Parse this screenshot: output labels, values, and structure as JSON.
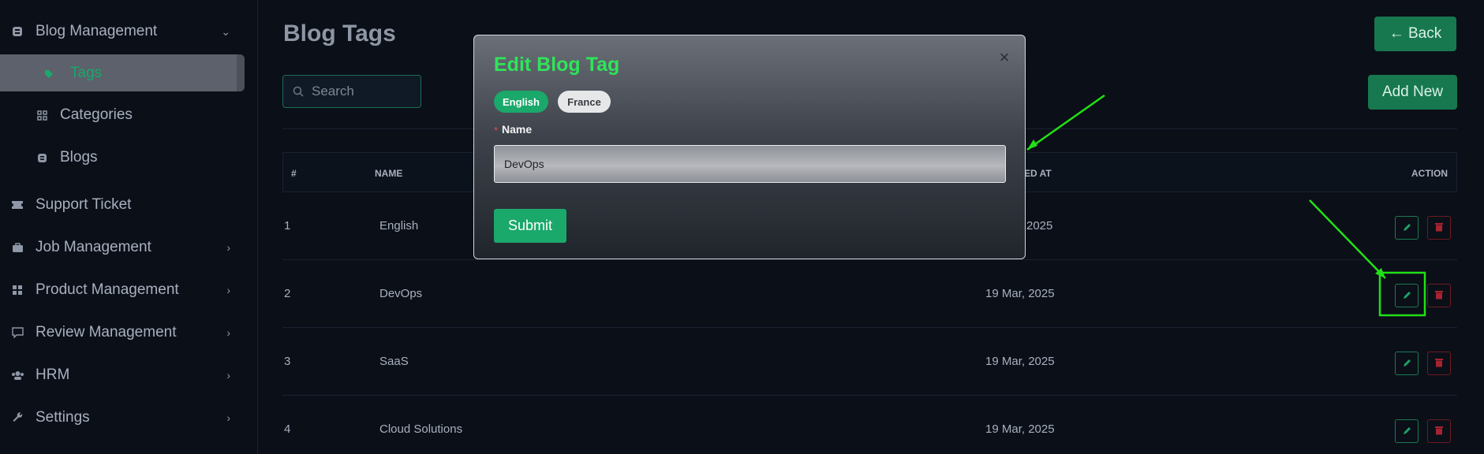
{
  "sidebar": {
    "blog_management": "Blog Management",
    "tags": "Tags",
    "categories": "Categories",
    "blogs": "Blogs",
    "support_ticket": "Support Ticket",
    "job_management": "Job Management",
    "product_management": "Product Management",
    "review_management": "Review Management",
    "hrm": "HRM",
    "settings": "Settings"
  },
  "header": {
    "title": "Blog Tags",
    "back_label": "← Back"
  },
  "toolbar": {
    "search_placeholder": "Search",
    "add_new_label": "Add New"
  },
  "table": {
    "headers": {
      "num": "#",
      "name": "NAME",
      "created_at": "SED AT",
      "action": "ACTION"
    },
    "rows": [
      {
        "num": "1",
        "name": "English",
        "created_at": "2025"
      },
      {
        "num": "2",
        "name": "DevOps",
        "created_at": "19 Mar, 2025"
      },
      {
        "num": "3",
        "name": "SaaS",
        "created_at": "19 Mar, 2025"
      },
      {
        "num": "4",
        "name": "Cloud Solutions",
        "created_at": "19 Mar, 2025"
      }
    ]
  },
  "modal": {
    "title": "Edit Blog Tag",
    "close": "×",
    "lang_english": "English",
    "lang_france": "France",
    "required_mark": "*",
    "name_label": "Name",
    "name_value": "DevOps",
    "submit_label": "Submit"
  },
  "colors": {
    "accent": "#1aa86b",
    "title_green": "#2ee55a",
    "annotation": "#22e016",
    "danger": "#a8232f"
  }
}
